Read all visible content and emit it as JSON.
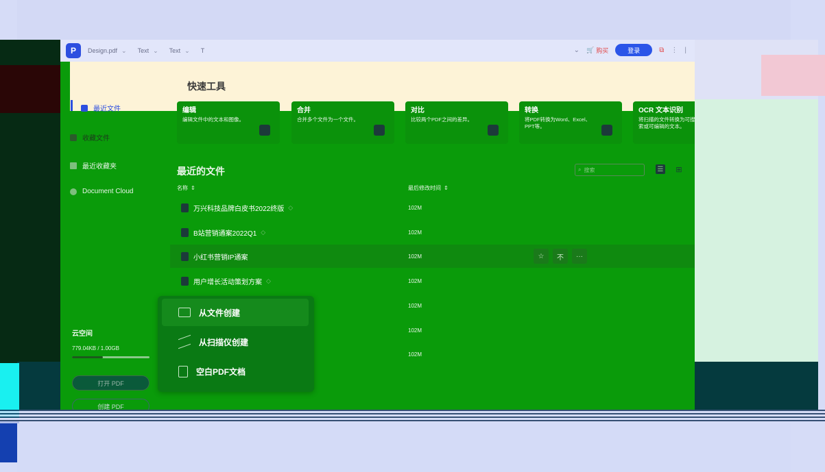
{
  "titlebar": {
    "file_name": "Design.pdf",
    "tabs": [
      "Text",
      "Text",
      "T"
    ],
    "cart_label": "购买",
    "login_label": "登录"
  },
  "sidebar": {
    "items": [
      {
        "label": "最近文件",
        "icon": "recent-icon"
      },
      {
        "label": "收藏文件",
        "icon": "star-icon"
      },
      {
        "label": "最近收藏夹",
        "icon": "folder-icon"
      },
      {
        "label": "Document Cloud",
        "icon": "cloud-icon"
      }
    ],
    "storage_title": "云空间",
    "storage_usage": "779.04KB / 1.00GB",
    "storage_fraction": 0.4,
    "open_button": "打开 PDF",
    "create_button": "创建 PDF"
  },
  "quick_tools": {
    "title": "快速工具",
    "tools": [
      {
        "name": "编辑",
        "desc": "编辑文件中的文本和图像。"
      },
      {
        "name": "合并",
        "desc": "合并多个文件为一个文件。"
      },
      {
        "name": "对比",
        "desc": "比较两个PDF之间的差异。"
      },
      {
        "name": "转换",
        "desc": "将PDF转换为Word、Excel、PPT等。"
      },
      {
        "name": "OCR 文本识别",
        "desc": "将扫描的文件转换为可搜索或可编辑的文本。"
      }
    ]
  },
  "recent_files": {
    "title": "最近的文件",
    "search_placeholder": "搜索",
    "columns": {
      "name": "名称",
      "modified": "最后修改时间"
    },
    "rows": [
      {
        "name": "万兴科技品牌白皮书2022终版",
        "size": "102M"
      },
      {
        "name": "B站营销通案2022Q1",
        "size": "102M"
      },
      {
        "name": "小红书营销IP通案",
        "size": "102M"
      },
      {
        "name": "用户增长活动策划方案",
        "size": "102M"
      }
    ],
    "extra_sizes": [
      "102M",
      "102M",
      "102M"
    ]
  },
  "row_actions": {
    "star": "☆",
    "pin": "不",
    "more": "···"
  },
  "popup": {
    "items": [
      "从文件创建",
      "从扫描仪创建",
      "空白PDF文档"
    ]
  }
}
